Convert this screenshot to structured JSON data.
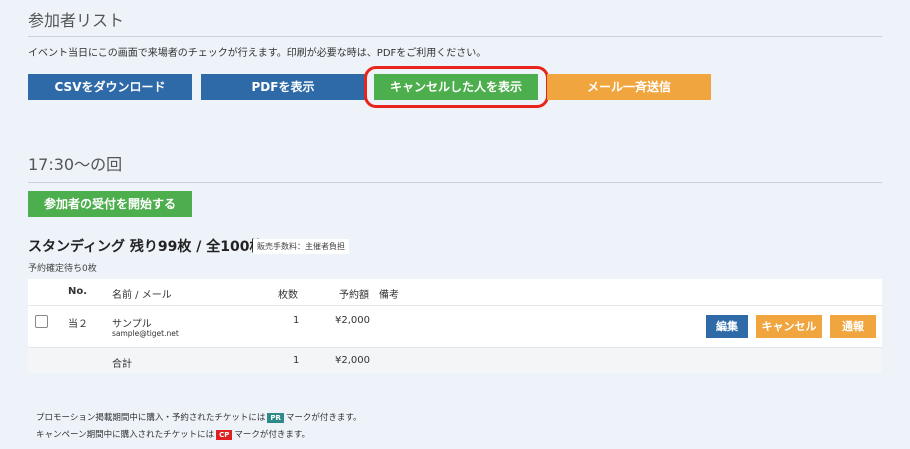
{
  "page": {
    "title": "参加者リスト",
    "notice": "イベント当日にこの画面で来場者のチェックが行えます。印刷が必要な時は、PDFをご利用ください。"
  },
  "toolbar": {
    "csv_label": "CSVをダウンロード",
    "pdf_label": "PDFを表示",
    "cancelled_label": "キャンセルした人を表示",
    "mail_label": "メール一斉送信"
  },
  "session": {
    "title": "17:30〜の回",
    "start_button": "参加者の受付を開始する"
  },
  "ticket": {
    "title": "スタンディング 残り99枚 / 全100枚",
    "fee_badge": "販売手数料：主催者負担",
    "pending": "予約確定待ち0枚"
  },
  "table": {
    "headers": {
      "no": "No.",
      "name": "名前 / メール",
      "count": "枚数",
      "amount": "予約額",
      "note": "備考"
    },
    "rows": [
      {
        "no": "当２",
        "name": "サンプル",
        "email": "sample@tiget.net",
        "count": "1",
        "amount": "¥2,000",
        "note": "",
        "edit_label": "編集",
        "cancel_label": "キャンセル",
        "report_label": "通報"
      }
    ],
    "total": {
      "label": "合計",
      "count": "1",
      "amount": "¥2,000"
    }
  },
  "footnotes": {
    "promo_before": "プロモーション掲載期間中に購入・予約されたチケットには",
    "promo_mark": "PR",
    "promo_after": "マークが付きます。",
    "campaign_before": "キャンペーン期間中に購入されたチケットには",
    "campaign_mark": "CP",
    "campaign_after": "マークが付きます。"
  },
  "colors": {
    "blue": "#2e6aa8",
    "green": "#4cae4c",
    "orange": "#f0a53f",
    "highlight": "#e8251a",
    "pr_mark": "#2f8a8a",
    "cp_mark": "#e02020"
  }
}
